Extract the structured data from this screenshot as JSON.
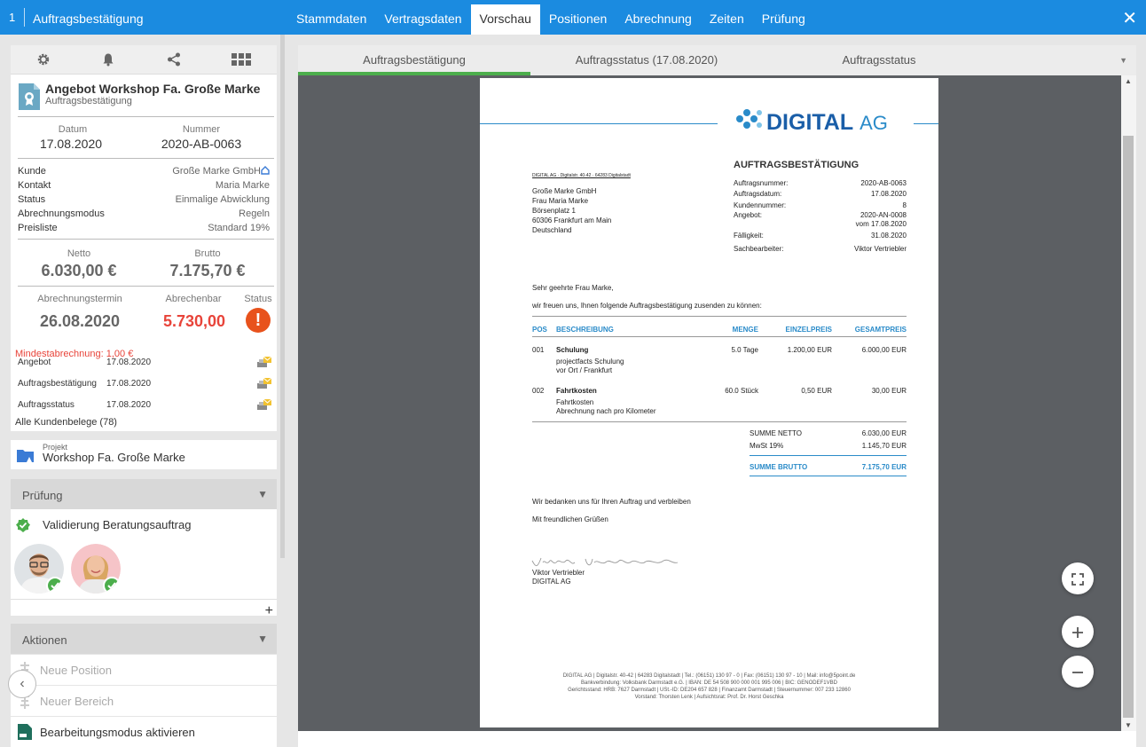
{
  "header": {
    "num": "1",
    "title": "Auftragsbestätigung",
    "close": "✕"
  },
  "tabs": [
    {
      "label": "Stammdaten"
    },
    {
      "label": "Vertragsdaten"
    },
    {
      "label": "Vorschau"
    },
    {
      "label": "Positionen"
    },
    {
      "label": "Abrechnung"
    },
    {
      "label": "Zeiten"
    },
    {
      "label": "Prüfung"
    }
  ],
  "doc": {
    "title": "Angebot Workshop Fa. Große Marke",
    "subtitle": "Auftragsbestätigung",
    "datum_label": "Datum",
    "datum": "17.08.2020",
    "nummer_label": "Nummer",
    "nummer": "2020-AB-0063",
    "fields": [
      {
        "k": "Kunde",
        "v": "Große Marke GmbH"
      },
      {
        "k": "Kontakt",
        "v": "Maria Marke"
      },
      {
        "k": "Status",
        "v": "Einmalige Abwicklung"
      },
      {
        "k": "Abrechnungsmodus",
        "v": "Regeln"
      },
      {
        "k": "Preisliste",
        "v": "Standard 19%"
      }
    ],
    "netto_label": "Netto",
    "netto": "6.030,00 €",
    "brutto_label": "Brutto",
    "brutto": "7.175,70 €",
    "termin_label": "Abrechnungstermin",
    "termin": "26.08.2020",
    "abr_label": "Abrechenbar",
    "abr": "5.730,00",
    "status_label": "Status",
    "status_icon": "!",
    "min": "Mindestabrechnung: 1,00 €",
    "belege": [
      {
        "n": "Angebot",
        "d": "17.08.2020"
      },
      {
        "n": "Auftragsbestätigung",
        "d": "17.08.2020"
      },
      {
        "n": "Auftragsstatus",
        "d": "17.08.2020"
      }
    ],
    "alle": "Alle Kundenbelege (78)"
  },
  "projekt": {
    "label": "Projekt",
    "value": "Workshop Fa. Große Marke"
  },
  "pruefung": {
    "title": "Prüfung",
    "item": "Validierung Beratungsauftrag",
    "plus": "+"
  },
  "aktionen": {
    "title": "Aktionen",
    "items": [
      {
        "label": "Neue Position"
      },
      {
        "label": "Neuer Bereich"
      },
      {
        "label": "Bearbeitungsmodus aktivieren"
      }
    ]
  },
  "back": "‹",
  "ptabs": [
    {
      "label": "Auftragsbestätigung"
    },
    {
      "label": "Auftragsstatus (17.08.2020)"
    },
    {
      "label": "Auftragsstatus"
    }
  ],
  "letter": {
    "logo1": "DIGITAL",
    "logo2": "AG",
    "sender": "DIGITAL AG · Digitalstr. 40-42 · 64283 Digitalstadt",
    "address": [
      "Große Marke GmbH",
      "Frau Maria Marke",
      "Börsenplatz 1",
      "60306 Frankfurt am Main",
      "Deutschland"
    ],
    "heading": "AUFTRAGSBESTÄTIGUNG",
    "info": [
      {
        "k": "Auftragsnummer:",
        "v": "2020-AB-0063"
      },
      {
        "k": "Auftragsdatum:",
        "v": "17.08.2020"
      },
      {
        "k": "Kundennummer:",
        "v": "8"
      },
      {
        "k": "Angebot:",
        "v": "2020-AN-0008"
      },
      {
        "k": "",
        "v": "vom 17.08.2020"
      },
      {
        "k": "Fälligkeit:",
        "v": "31.08.2020"
      },
      {
        "k": "Sachbearbeiter:",
        "v": "Viktor Vertriebler"
      }
    ],
    "greeting": "Sehr geehrte Frau Marke,",
    "intro": "wir freuen uns, Ihnen folgende Auftragsbestätigung zusenden zu können:",
    "cols": [
      "POS",
      "BESCHREIBUNG",
      "MENGE",
      "EINZELPREIS",
      "GESAMTPREIS"
    ],
    "rows": [
      {
        "pos": "001",
        "name": "Schulung",
        "desc1": "projectfacts Schulung",
        "desc2": "vor Ort / Frankfurt",
        "menge": "5.0 Tage",
        "ep": "1.200,00 EUR",
        "gp": "6.000,00 EUR"
      },
      {
        "pos": "002",
        "name": "Fahrtkosten",
        "desc1": "Fahrtkosten",
        "desc2": "Abrechnung nach pro Kilometer",
        "menge": "60.0 Stück",
        "ep": "0,50 EUR",
        "gp": "30,00 EUR"
      }
    ],
    "sum_netto_l": "SUMME NETTO",
    "sum_netto": "6.030,00 EUR",
    "mwst_l": "MwSt 19%",
    "mwst": "1.145,70 EUR",
    "sum_brutto_l": "SUMME BRUTTO",
    "sum_brutto": "7.175,70 EUR",
    "thanks": "Wir bedanken uns für Ihren Auftrag und verbleiben",
    "regards": "Mit freundlichen Grüßen",
    "sign_name": "Viktor Vertriebler",
    "sign_co": "DIGITAL AG",
    "footer": [
      "DIGITAL AG | Digitalstr. 40-42 | 64283 Digitalstadt | Tel.: (06151) 130 97 - 0 | Fax: (06151) 130 97 - 10 | Mail: info@5point.de",
      "Bankverbindung: Volksbank Darmstadt e.G. | IBAN: DE 54 508 900 000 001 995 006 | BIC: GENODEF1VBD",
      "Gerichtsstand: HRB: 7627 Darmstadt | USt.-ID: DE204 657 828 | Finanzamt Darmstadt | Steuernummer: 007 233 12860",
      "Vorstand: Thorsten Lenk | Aufsichtsrat: Prof. Dr. Horst Geschka"
    ]
  },
  "colors": {
    "primary": "#1b8be0",
    "accent": "#2a8bc9",
    "danger": "#e8443a",
    "success": "#4cae4c"
  }
}
